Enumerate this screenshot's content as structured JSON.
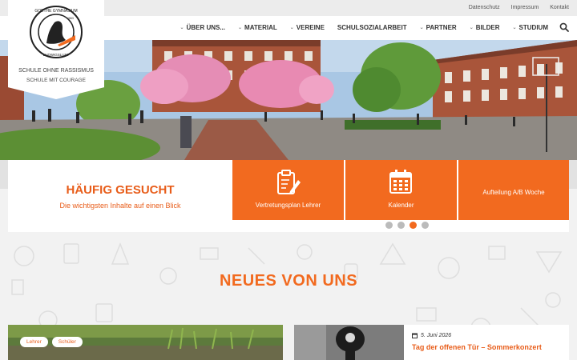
{
  "top_links": [
    "Datenschutz",
    "Impressum",
    "Kontakt"
  ],
  "nav": {
    "items": [
      {
        "label": "Über uns...",
        "chevron": true
      },
      {
        "label": "Material",
        "chevron": true
      },
      {
        "label": "Vereine",
        "chevron": true
      },
      {
        "label": "Schulsozialarbeit",
        "chevron": false
      },
      {
        "label": "Partner",
        "chevron": true
      },
      {
        "label": "Bilder",
        "chevron": true
      },
      {
        "label": "Studium",
        "chevron": true
      }
    ],
    "search_icon": "search-icon"
  },
  "logo": {
    "ring_top": "GOETHE GYMNASIUM",
    "ring_bottom": "LUDWIGSLUST",
    "year": "1863",
    "badge_1": "SCHULE OHNE RASSISMUS",
    "badge_2": "SCHULE MIT COURAGE"
  },
  "quick": {
    "title": "HÄUFIG GESUCHT",
    "subtitle": "Die wichtigsten Inhalte auf einen Blick",
    "tiles": [
      {
        "label": "Vertretungsplan Lehrer",
        "icon": "clipboard-edit-icon"
      },
      {
        "label": "Kalender",
        "icon": "calendar-icon"
      },
      {
        "label": "Aufteilung A/B Woche",
        "icon": ""
      }
    ],
    "slides": 4,
    "active_slide": 3
  },
  "news": {
    "section_title": "NEUES VON UNS",
    "card1_tags": [
      "Lehrer",
      "Schüler"
    ],
    "card2": {
      "date": "5. Juni 2026",
      "headline": "Tag der offenen Tür – Sommerkonzert"
    }
  },
  "colors": {
    "accent": "#f26a1f",
    "accent_text": "#e85d1a"
  }
}
